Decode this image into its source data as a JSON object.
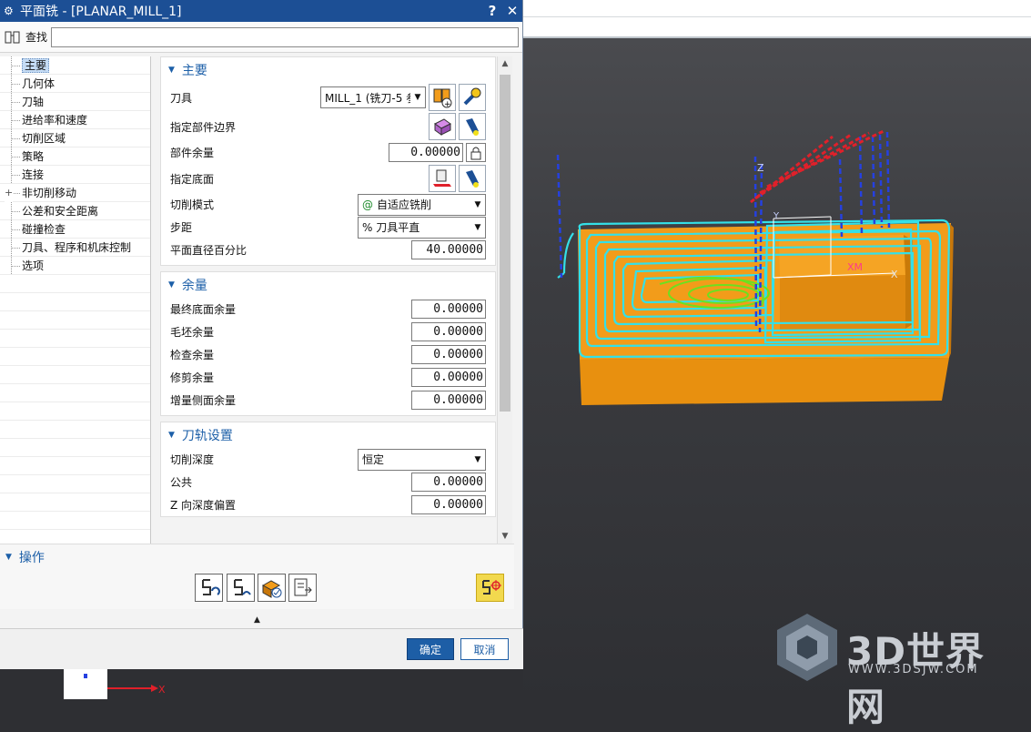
{
  "dialog": {
    "title": "平面铣 - [PLANAR_MILL_1]",
    "help_label": "?",
    "close_label": "✕",
    "find_label": "查找",
    "find_value": ""
  },
  "nav": {
    "items": [
      {
        "label": "主要",
        "selected": true
      },
      {
        "label": "几何体"
      },
      {
        "label": "刀轴"
      },
      {
        "label": "进给率和速度"
      },
      {
        "label": "切削区域"
      },
      {
        "label": "策略"
      },
      {
        "label": "连接"
      },
      {
        "label": "非切削移动",
        "expandable": true,
        "expand_glyph": "+"
      },
      {
        "label": "公差和安全距离"
      },
      {
        "label": "碰撞检查"
      },
      {
        "label": "刀具、程序和机床控制"
      },
      {
        "label": "选项"
      }
    ]
  },
  "main": {
    "title": "主要",
    "tool_label": "刀具",
    "tool_value": "MILL_1 (铣刀-5 参",
    "part_boundary_label": "指定部件边界",
    "part_stock_label": "部件余量",
    "part_stock_value": "0.00000",
    "floor_label": "指定底面",
    "cut_pattern_label": "切削模式",
    "cut_pattern_value": "自适应铣削",
    "stepover_label": "步距",
    "stepover_value": "% 刀具平直",
    "flat_diameter_label": "平面直径百分比",
    "flat_diameter_value": "40.00000"
  },
  "stock": {
    "title": "余量",
    "final_floor_label": "最终底面余量",
    "final_floor_value": "0.00000",
    "blank_label": "毛坯余量",
    "blank_value": "0.00000",
    "check_label": "检查余量",
    "check_value": "0.00000",
    "trim_label": "修剪余量",
    "trim_value": "0.00000",
    "incremental_side_label": "增量侧面余量",
    "incremental_side_value": "0.00000"
  },
  "path": {
    "title": "刀轨设置",
    "cut_depth_label": "切削深度",
    "cut_depth_value": "恒定",
    "common_label": "公共",
    "common_value": "0.00000",
    "z_offset_label": "Z 向深度偏置",
    "z_offset_value": "0.00000"
  },
  "ops": {
    "title": "操作"
  },
  "footer": {
    "ok_label": "确定",
    "cancel_label": "取消"
  },
  "viewport": {
    "xm_label": "XM",
    "zm_label": "Z",
    "y_label": "Y",
    "x_label": "X",
    "triad_x_label": "X"
  },
  "watermark": {
    "brand": "3D世界网",
    "url": "WWW.3DSJW.COM"
  },
  "colors": {
    "title_bar": "#1c4f95",
    "section_header": "#1c5fa8",
    "part_orange": "#f29c1a",
    "toolpath_cyan": "#34e0e8",
    "toolpath_green": "#6de01f",
    "rapid_red": "#e0202a",
    "rapid_blue": "#2540e0"
  }
}
